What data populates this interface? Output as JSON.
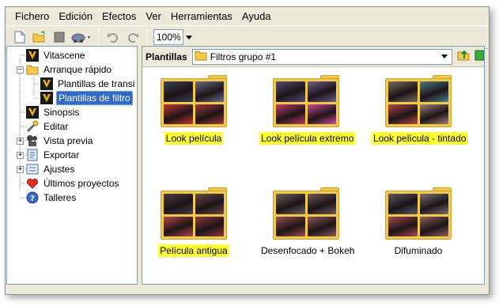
{
  "menu": [
    "Fichero",
    "Edición",
    "Efectos",
    "Ver",
    "Herramientas",
    "Ayuda"
  ],
  "toolbar": {
    "buttons": [
      "new-icon",
      "open-icon",
      "stop-icon",
      "vehicle-icon",
      "undo-icon",
      "redo-icon"
    ],
    "zoom": "100%"
  },
  "tree": {
    "items": [
      {
        "label": "Vitascene",
        "icon": "vitascene-icon"
      },
      {
        "label": "Arranque rápido",
        "icon": "folder-open-icon"
      },
      {
        "label": "Plantillas de transi",
        "icon": "vitascene-icon"
      },
      {
        "label": "Plantillas de filtro",
        "icon": "vitascene-icon"
      },
      {
        "label": "Sinopsis",
        "icon": "vitascene-icon"
      },
      {
        "label": "Editar",
        "icon": "wrench-icon"
      },
      {
        "label": "Vista previa",
        "icon": "preview-icon"
      },
      {
        "label": "Exportar",
        "icon": "export-icon"
      },
      {
        "label": "Ajustes",
        "icon": "settings-icon"
      },
      {
        "label": "Últimos proyectos",
        "icon": "heart-icon"
      },
      {
        "label": "Talleres",
        "icon": "help-icon"
      }
    ]
  },
  "panel": {
    "title": "Plantillas",
    "folder": "Filtros grupo #1"
  },
  "templates": [
    {
      "label": "Look película",
      "highlighted": true,
      "palette": [
        "#3b3f5a",
        "#6b6f86",
        "#c2362f",
        "#a23a32"
      ]
    },
    {
      "label": "Look película extremo",
      "highlighted": true,
      "palette": [
        "#5a4a78",
        "#6f5c8a",
        "#c23a6a",
        "#d04a9a"
      ]
    },
    {
      "label": "Look película - tintado",
      "highlighted": true,
      "palette": [
        "#7a6b60",
        "#4d7c86",
        "#b44a45",
        "#9e8076"
      ]
    },
    {
      "label": "Película antigua",
      "highlighted": true,
      "palette": [
        "#4d3a40",
        "#6a4a40",
        "#b8444a",
        "#8e3a3c"
      ]
    },
    {
      "label": "Desenfocado + Bokeh",
      "highlighted": false,
      "palette": [
        "#6e6060",
        "#705a5a",
        "#9c5050",
        "#8a5858"
      ]
    },
    {
      "label": "Difuminado",
      "highlighted": false,
      "palette": [
        "#5e5666",
        "#7a7074",
        "#a64a52",
        "#90605e"
      ]
    }
  ]
}
